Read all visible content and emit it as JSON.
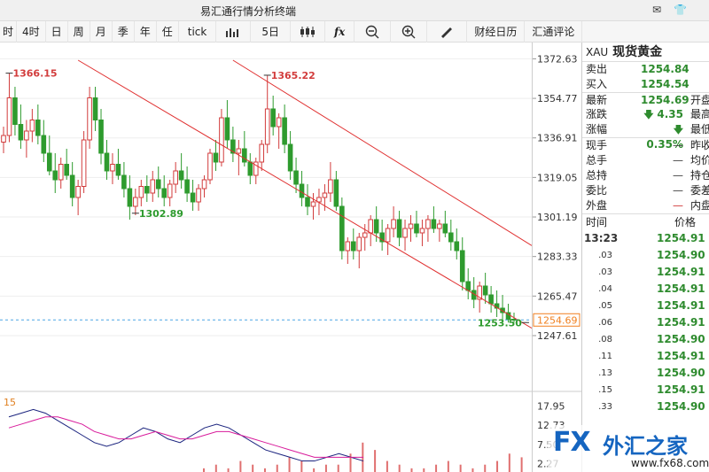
{
  "window": {
    "title": "易汇通行情分析终端"
  },
  "toolbar": {
    "periods": [
      "时",
      "4时",
      "日",
      "周",
      "月",
      "季",
      "年",
      "任",
      "tick"
    ],
    "five_day": "5日",
    "calendar": "财经日历",
    "commentary": "汇通评论"
  },
  "colors": {
    "up": "#d23c3c",
    "down": "#2e9b2e",
    "channel": "#e03030",
    "dashed": "#4da6e6",
    "macd_k": "#1a237e",
    "macd_d": "#d81b9b"
  },
  "quote": {
    "symbol": "XAU",
    "name": "现货黄金",
    "rows": [
      {
        "label": "卖出",
        "value": "1254.84",
        "rlabel": "",
        "arrow": false
      },
      {
        "label": "买入",
        "value": "1254.54",
        "rlabel": "",
        "arrow": false
      },
      {
        "label": "最新",
        "value": "1254.69",
        "rlabel": "开盘",
        "arrow": false
      },
      {
        "label": "涨跌",
        "value": "4.35",
        "rlabel": "最高",
        "arrow": true
      },
      {
        "label": "涨幅",
        "value": "0.35%",
        "rlabel": "最低",
        "arrow": true
      }
    ],
    "details": [
      {
        "label": "现手",
        "value": "—",
        "rlabel": "昨收"
      },
      {
        "label": "总手",
        "value": "—",
        "rlabel": "均价"
      },
      {
        "label": "总持",
        "value": "—",
        "rlabel": "持仓"
      },
      {
        "label": "委比",
        "value": "—",
        "rlabel": "委差"
      },
      {
        "label": "外盘",
        "value": "—",
        "rlabel": "内盘"
      }
    ]
  },
  "ticks": {
    "header_time": "时间",
    "header_price": "价格",
    "rows": [
      {
        "time": "13:23",
        "price": "1254.91"
      },
      {
        "time": ".03",
        "price": "1254.90"
      },
      {
        "time": ".03",
        "price": "1254.91"
      },
      {
        "time": ".04",
        "price": "1254.91"
      },
      {
        "time": ".05",
        "price": "1254.91"
      },
      {
        "time": ".06",
        "price": "1254.91"
      },
      {
        "time": ".08",
        "price": "1254.90"
      },
      {
        "time": ".11",
        "price": "1254.91"
      },
      {
        "time": ".13",
        "price": "1254.90"
      },
      {
        "time": ".15",
        "price": "1254.91"
      },
      {
        "time": ".33",
        "price": "1254.90"
      }
    ]
  },
  "watermark": {
    "logo": "FX",
    "name": "外汇之家",
    "url": "www.fx68.com"
  },
  "chart_data": {
    "type": "candlestick",
    "y_ticks": [
      1372.63,
      1354.77,
      1336.91,
      1319.05,
      1301.19,
      1283.33,
      1265.47,
      1247.61
    ],
    "ylim": [
      1236,
      1376
    ],
    "current_price": "1254.69",
    "annotations": [
      {
        "text": "1366.15",
        "index": 1,
        "price": 1366.15,
        "kind": "high"
      },
      {
        "text": "1365.22",
        "index": 46,
        "price": 1365.22,
        "kind": "high"
      },
      {
        "text": "1302.89",
        "index": 23,
        "price": 1302.89,
        "kind": "low"
      },
      {
        "text": "1253.50",
        "index": 91,
        "price": 1253.5,
        "kind": "low"
      }
    ],
    "channel": [
      {
        "from": [
          13,
          1372
        ],
        "to": [
          96,
          1245
        ]
      },
      {
        "from": [
          40,
          1372
        ],
        "to": [
          96,
          1282
        ]
      }
    ],
    "ohlc": [
      [
        1335,
        1342,
        1330,
        1338
      ],
      [
        1338,
        1366,
        1335,
        1355
      ],
      [
        1355,
        1360,
        1338,
        1343
      ],
      [
        1343,
        1352,
        1332,
        1336
      ],
      [
        1336,
        1345,
        1328,
        1340
      ],
      [
        1340,
        1350,
        1335,
        1345
      ],
      [
        1345,
        1352,
        1334,
        1338
      ],
      [
        1338,
        1345,
        1326,
        1330
      ],
      [
        1330,
        1338,
        1320,
        1322
      ],
      [
        1322,
        1330,
        1312,
        1318
      ],
      [
        1318,
        1328,
        1314,
        1325
      ],
      [
        1325,
        1332,
        1318,
        1320
      ],
      [
        1320,
        1326,
        1306,
        1310
      ],
      [
        1310,
        1318,
        1302,
        1315
      ],
      [
        1315,
        1340,
        1312,
        1336
      ],
      [
        1336,
        1360,
        1332,
        1355
      ],
      [
        1355,
        1360,
        1340,
        1345
      ],
      [
        1345,
        1350,
        1325,
        1330
      ],
      [
        1330,
        1336,
        1318,
        1322
      ],
      [
        1322,
        1330,
        1316,
        1325
      ],
      [
        1325,
        1332,
        1318,
        1320
      ],
      [
        1320,
        1326,
        1310,
        1314
      ],
      [
        1314,
        1320,
        1300,
        1306
      ],
      [
        1306,
        1314,
        1302,
        1310
      ],
      [
        1310,
        1318,
        1306,
        1315
      ],
      [
        1315,
        1320,
        1308,
        1312
      ],
      [
        1312,
        1322,
        1308,
        1318
      ],
      [
        1318,
        1324,
        1310,
        1314
      ],
      [
        1314,
        1320,
        1306,
        1310
      ],
      [
        1310,
        1318,
        1306,
        1316
      ],
      [
        1316,
        1326,
        1312,
        1322
      ],
      [
        1322,
        1330,
        1314,
        1318
      ],
      [
        1318,
        1324,
        1308,
        1312
      ],
      [
        1312,
        1318,
        1304,
        1308
      ],
      [
        1308,
        1316,
        1304,
        1314
      ],
      [
        1314,
        1320,
        1310,
        1318
      ],
      [
        1318,
        1332,
        1316,
        1330
      ],
      [
        1330,
        1336,
        1322,
        1326
      ],
      [
        1326,
        1350,
        1324,
        1346
      ],
      [
        1346,
        1354,
        1332,
        1336
      ],
      [
        1336,
        1342,
        1326,
        1330
      ],
      [
        1330,
        1336,
        1320,
        1332
      ],
      [
        1332,
        1340,
        1324,
        1326
      ],
      [
        1326,
        1330,
        1316,
        1320
      ],
      [
        1320,
        1328,
        1316,
        1326
      ],
      [
        1326,
        1336,
        1322,
        1334
      ],
      [
        1334,
        1365,
        1330,
        1350
      ],
      [
        1350,
        1356,
        1338,
        1342
      ],
      [
        1342,
        1348,
        1332,
        1346
      ],
      [
        1346,
        1352,
        1330,
        1334
      ],
      [
        1334,
        1340,
        1318,
        1322
      ],
      [
        1322,
        1328,
        1312,
        1316
      ],
      [
        1316,
        1322,
        1306,
        1310
      ],
      [
        1310,
        1316,
        1302,
        1306
      ],
      [
        1306,
        1312,
        1300,
        1308
      ],
      [
        1308,
        1314,
        1302,
        1310
      ],
      [
        1310,
        1316,
        1304,
        1312
      ],
      [
        1312,
        1326,
        1308,
        1318
      ],
      [
        1318,
        1322,
        1304,
        1306
      ],
      [
        1306,
        1310,
        1282,
        1286
      ],
      [
        1286,
        1292,
        1280,
        1290
      ],
      [
        1290,
        1296,
        1282,
        1286
      ],
      [
        1286,
        1294,
        1278,
        1292
      ],
      [
        1292,
        1298,
        1286,
        1294
      ],
      [
        1294,
        1302,
        1288,
        1300
      ],
      [
        1300,
        1306,
        1290,
        1294
      ],
      [
        1294,
        1300,
        1286,
        1290
      ],
      [
        1290,
        1298,
        1284,
        1296
      ],
      [
        1296,
        1306,
        1292,
        1300
      ],
      [
        1300,
        1304,
        1288,
        1292
      ],
      [
        1292,
        1300,
        1286,
        1296
      ],
      [
        1296,
        1302,
        1290,
        1298
      ],
      [
        1298,
        1304,
        1292,
        1294
      ],
      [
        1294,
        1300,
        1288,
        1296
      ],
      [
        1296,
        1302,
        1290,
        1300
      ],
      [
        1300,
        1306,
        1294,
        1296
      ],
      [
        1296,
        1300,
        1290,
        1298
      ],
      [
        1298,
        1304,
        1292,
        1294
      ],
      [
        1294,
        1300,
        1286,
        1290
      ],
      [
        1290,
        1296,
        1282,
        1286
      ],
      [
        1286,
        1292,
        1268,
        1272
      ],
      [
        1272,
        1278,
        1264,
        1268
      ],
      [
        1268,
        1274,
        1260,
        1264
      ],
      [
        1264,
        1272,
        1258,
        1270
      ],
      [
        1270,
        1276,
        1262,
        1266
      ],
      [
        1266,
        1270,
        1258,
        1262
      ],
      [
        1262,
        1268,
        1256,
        1260
      ],
      [
        1260,
        1266,
        1254,
        1258
      ],
      [
        1258,
        1262,
        1253.5,
        1255
      ],
      [
        1255,
        1258,
        1253.5,
        1254.69
      ]
    ],
    "indicator": {
      "label": "15",
      "y_ticks": [
        17.95,
        12.73,
        7.5,
        2.27
      ],
      "ylim": [
        0,
        20
      ],
      "k": [
        15,
        16,
        17,
        16,
        14,
        12,
        10,
        8,
        7,
        8,
        10,
        12,
        11,
        9,
        8,
        10,
        12,
        13,
        12,
        10,
        8,
        6,
        5,
        4,
        3,
        3,
        4,
        5,
        4,
        3
      ],
      "d": [
        12,
        13,
        14,
        15,
        15,
        14,
        13,
        11,
        10,
        9,
        9,
        10,
        11,
        10,
        9,
        9,
        10,
        11,
        11,
        10,
        9,
        8,
        7,
        6,
        5,
        4,
        4,
        4,
        4,
        4
      ],
      "bars": [
        1,
        2,
        1,
        3,
        2,
        1,
        2,
        4,
        3,
        1,
        2,
        2,
        5,
        8,
        6,
        3,
        2,
        1,
        1,
        2,
        3,
        2,
        1,
        2,
        3,
        5,
        4,
        2,
        1,
        2
      ]
    }
  }
}
